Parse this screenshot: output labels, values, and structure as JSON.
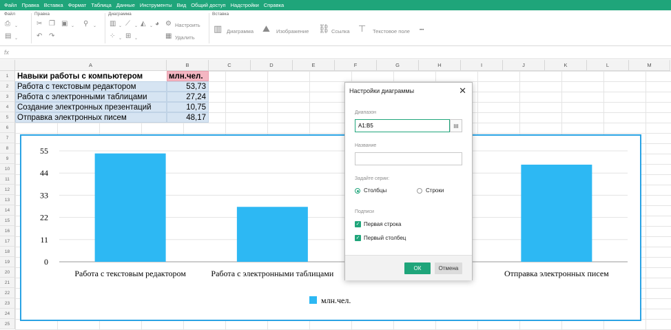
{
  "menu": [
    "Файл",
    "Правка",
    "Вставка",
    "Формат",
    "Таблица",
    "Данные",
    "Инструменты",
    "Вид",
    "Общий доступ",
    "Надстройки",
    "Справка"
  ],
  "ribbon": {
    "groups": {
      "file": "Файл",
      "edit": "Правка",
      "chart": "Диаграмма",
      "insert": "Вставка"
    },
    "chart_settings": "Настроить",
    "chart_delete": "Удалить",
    "insert_items": [
      "Диаграмма",
      "Изображение",
      "Ссылка",
      "Текстовое поле"
    ],
    "more": "•••"
  },
  "formula_bar": {
    "fx": "fx",
    "value": ""
  },
  "columns": [
    "A",
    "B",
    "C",
    "D",
    "E",
    "F",
    "G",
    "H",
    "I",
    "J",
    "K",
    "L",
    "M"
  ],
  "rows": [
    "1",
    "2",
    "3",
    "4",
    "5",
    "6",
    "7",
    "8",
    "9",
    "10",
    "11",
    "12",
    "13",
    "14",
    "15",
    "16",
    "17",
    "18",
    "19",
    "20",
    "21",
    "22",
    "23",
    "24",
    "25"
  ],
  "sheet": {
    "header": {
      "a": "Навыки работы с компьютером",
      "b": "млн.чел."
    },
    "data": [
      {
        "a": "Работа с текстовым редактором",
        "b": "53,73"
      },
      {
        "a": "Работа с электронными таблицами",
        "b": "27,24"
      },
      {
        "a": "Создание электронных презентаций",
        "b": "10,75"
      },
      {
        "a": "Отправка электронных писем",
        "b": "48,17"
      }
    ]
  },
  "chart_data": {
    "type": "bar",
    "categories": [
      "Работа с текстовым редактором",
      "Работа с электронными таблицами",
      "Создание электронных презентаций",
      "Отправка электронных писем"
    ],
    "visible_category_labels": [
      "Работа с текстовым редактором",
      "Работа с электронными таблицами",
      "й",
      "Отправка электронных писем"
    ],
    "series": [
      {
        "name": "млн.чел.",
        "values": [
          53.73,
          27.24,
          10.75,
          48.17
        ],
        "color": "#2db8f3"
      }
    ],
    "yticks": [
      "0",
      "11",
      "22",
      "33",
      "44",
      "55"
    ],
    "ylim": [
      0,
      55
    ],
    "grid": true,
    "legend": "bottom",
    "frame_color": "#2aa3e4"
  },
  "dialog": {
    "title": "Настройки диаграммы",
    "range_label": "Диапазон",
    "range_value": "A1:B5",
    "name_label": "Название",
    "name_value": "",
    "series_label": "Задайте серии:",
    "opt_columns": "Столбцы",
    "opt_rows": "Строки",
    "captions_label": "Подписи",
    "first_row": "Первая строка",
    "first_col": "Первый столбец",
    "ok": "ОК",
    "cancel": "Отмена"
  },
  "colors": {
    "accent": "#1fa57a",
    "selection": "#d6e4f2",
    "header_highlight": "#f4b6c2"
  }
}
